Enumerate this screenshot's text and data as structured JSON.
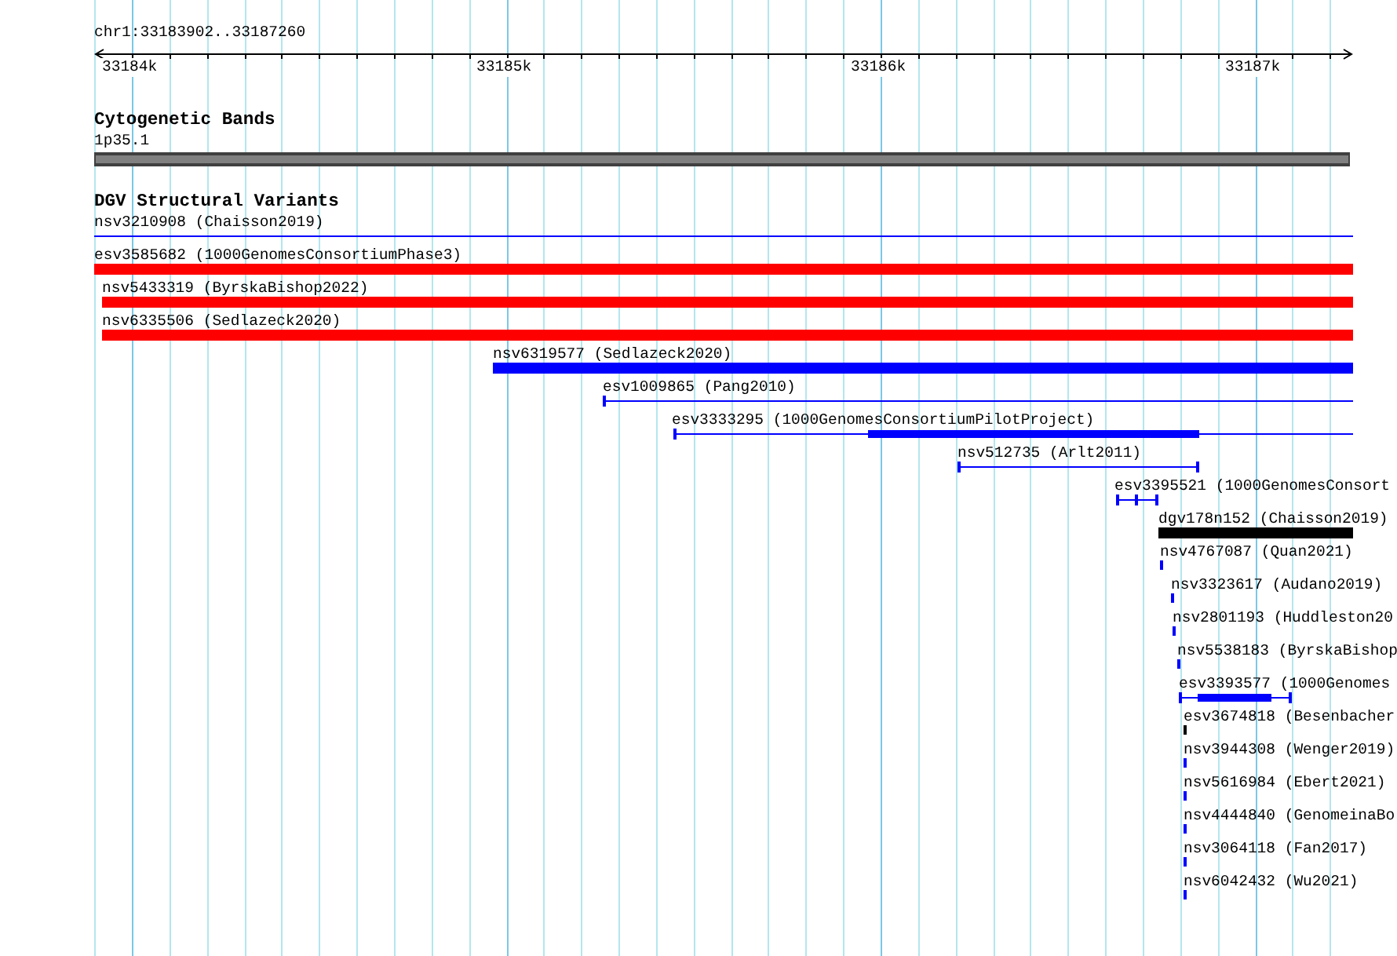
{
  "location": "chr1:33183902..33187260",
  "ruler": {
    "ticks": [
      {
        "label": "33184k"
      },
      {
        "label": "33185k"
      },
      {
        "label": "33186k"
      },
      {
        "label": "33187k"
      }
    ]
  },
  "tracks": [
    {
      "title": "Cytogenetic Bands",
      "kind": "cytoband",
      "bands": [
        {
          "name": "1p35.1"
        }
      ]
    },
    {
      "title": "DGV Structural Variants",
      "kind": "variants",
      "features": [
        {
          "label": "nsv3210908 (Chaisson2019)",
          "kind": "line",
          "color": "#0000ff"
        },
        {
          "label": "esv3585682 (1000GenomesConsortiumPhase3)",
          "kind": "bar",
          "color": "#ff0000"
        },
        {
          "label": "nsv5433319 (ByrskaBishop2022)",
          "kind": "bar",
          "color": "#ff0000"
        },
        {
          "label": "nsv6335506 (Sedlazeck2020)",
          "kind": "bar",
          "color": "#ff0000"
        },
        {
          "label": "nsv6319577 (Sedlazeck2020)",
          "kind": "bar",
          "color": "#0000ff"
        },
        {
          "label": "esv1009865 (Pang2010)",
          "kind": "span",
          "color": "#0000ff"
        },
        {
          "label": "esv3333295 (1000GenomesConsortiumPilotProject)",
          "kind": "block_span",
          "color": "#0000ff"
        },
        {
          "label": "nsv512735 (Arlt2011)",
          "kind": "span",
          "color": "#0000ff"
        },
        {
          "label": "esv3395521 (1000GenomesConsort",
          "kind": "span",
          "color": "#0000ff"
        },
        {
          "label": "dgv178n152 (Chaisson2019)",
          "kind": "bar",
          "color": "#000000"
        },
        {
          "label": "nsv4767087 (Quan2021)",
          "kind": "mark",
          "color": "#0000ff"
        },
        {
          "label": "nsv3323617 (Audano2019)",
          "kind": "mark",
          "color": "#0000ff"
        },
        {
          "label": "nsv2801193 (Huddleston20",
          "kind": "mark",
          "color": "#0000ff"
        },
        {
          "label": "nsv5538183 (ByrskaBishop",
          "kind": "mark",
          "color": "#0000ff"
        },
        {
          "label": "esv3393577 (1000Genomes",
          "kind": "block_span",
          "color": "#0000ff"
        },
        {
          "label": "esv3674818 (Besenbacher",
          "kind": "mark",
          "color": "#000000"
        },
        {
          "label": "nsv3944308 (Wenger2019)",
          "kind": "mark",
          "color": "#0000ff"
        },
        {
          "label": "nsv5616984 (Ebert2021)",
          "kind": "mark",
          "color": "#0000ff"
        },
        {
          "label": "nsv4444840 (GenomeinaBo",
          "kind": "mark",
          "color": "#0000ff"
        },
        {
          "label": "nsv3064118 (Fan2017)",
          "kind": "mark",
          "color": "#0000ff"
        },
        {
          "label": "nsv6042432 (Wu2021)",
          "kind": "mark",
          "color": "#0000ff"
        }
      ]
    }
  ]
}
